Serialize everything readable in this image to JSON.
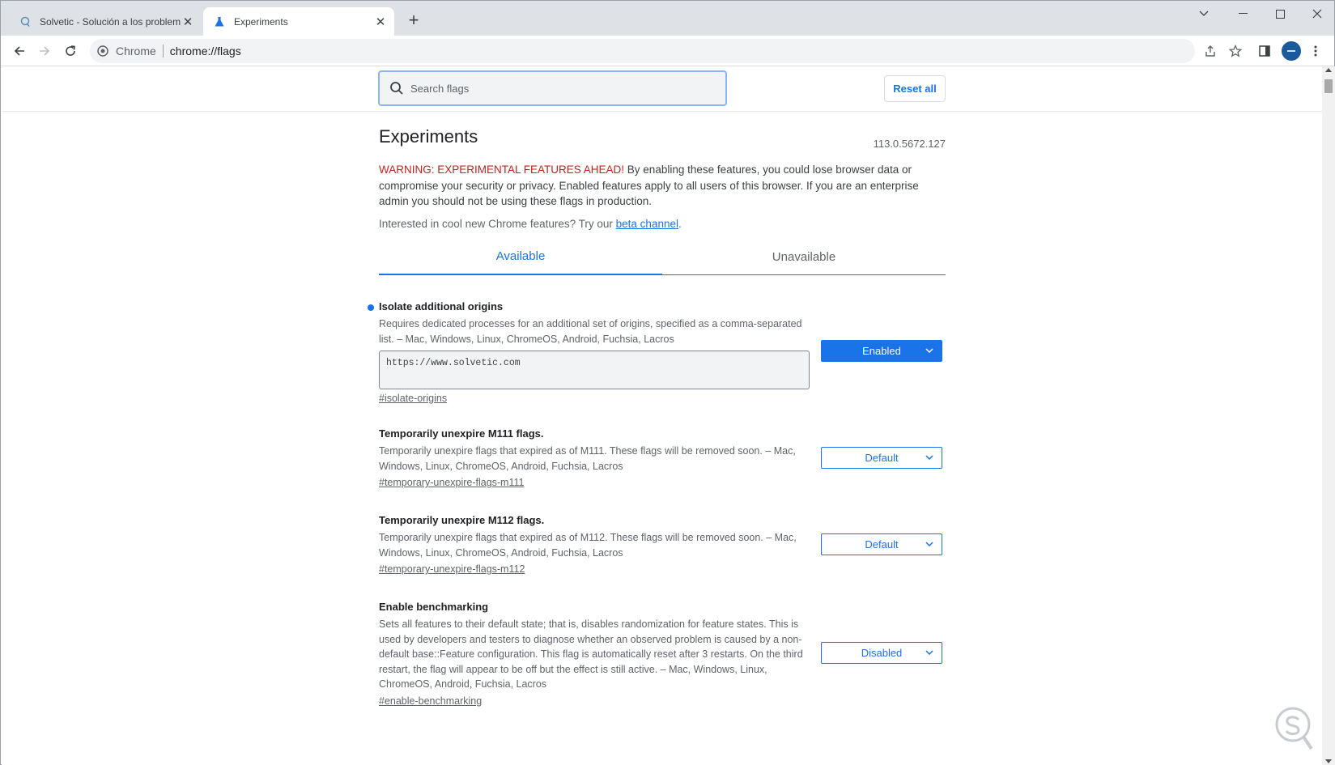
{
  "tabs": [
    {
      "title": "Solvetic - Solución a los problem",
      "icon": "magnifier-icon"
    },
    {
      "title": "Experiments",
      "icon": "flask-icon"
    }
  ],
  "toolbar": {
    "chip": "Chrome",
    "url": "chrome://flags"
  },
  "flags_header": {
    "search_placeholder": "Search flags",
    "reset_label": "Reset all"
  },
  "page": {
    "title": "Experiments",
    "version": "113.0.5672.127",
    "warning_red": "WARNING: EXPERIMENTAL FEATURES AHEAD!",
    "warning_text": " By enabling these features, you could lose browser data or compromise your security or privacy. Enabled features apply to all users of this browser. If you are an enterprise admin you should not be using these flags in production.",
    "interest_text": "Interested in cool new Chrome features? Try our ",
    "interest_link": "beta channel",
    "interest_end": ".",
    "tabs": [
      "Available",
      "Unavailable"
    ]
  },
  "experiments": [
    {
      "name": "Isolate additional origins",
      "desc": "Requires dedicated processes for an additional set of origins, specified as a comma-separated list. – Mac, Windows, Linux, ChromeOS, Android, Fuchsia, Lacros",
      "value": "https://www.solvetic.com",
      "link": "#isolate-origins",
      "state": "Enabled",
      "modified": true
    },
    {
      "name": "Temporarily unexpire M111 flags.",
      "desc": "Temporarily unexpire flags that expired as of M111. These flags will be removed soon. – Mac, Windows, Linux, ChromeOS, Android, Fuchsia, Lacros",
      "link": "#temporary-unexpire-flags-m111",
      "state": "Default"
    },
    {
      "name": "Temporarily unexpire M112 flags.",
      "desc": "Temporarily unexpire flags that expired as of M112. These flags will be removed soon. – Mac, Windows, Linux, ChromeOS, Android, Fuchsia, Lacros",
      "link": "#temporary-unexpire-flags-m112",
      "state": "Default"
    },
    {
      "name": "Enable benchmarking",
      "desc": "Sets all features to their default state; that is, disables randomization for feature states. This is used by developers and testers to diagnose whether an observed problem is caused by a non-default base::Feature configuration. This flag is automatically reset after 3 restarts. On the third restart, the flag will appear to be off but the effect is still active. – Mac, Windows, Linux, ChromeOS, Android, Fuchsia, Lacros",
      "link": "#enable-benchmarking",
      "state": "Disabled"
    }
  ],
  "colors": {
    "accent": "#1a73e8",
    "warning": "#c5221f"
  }
}
